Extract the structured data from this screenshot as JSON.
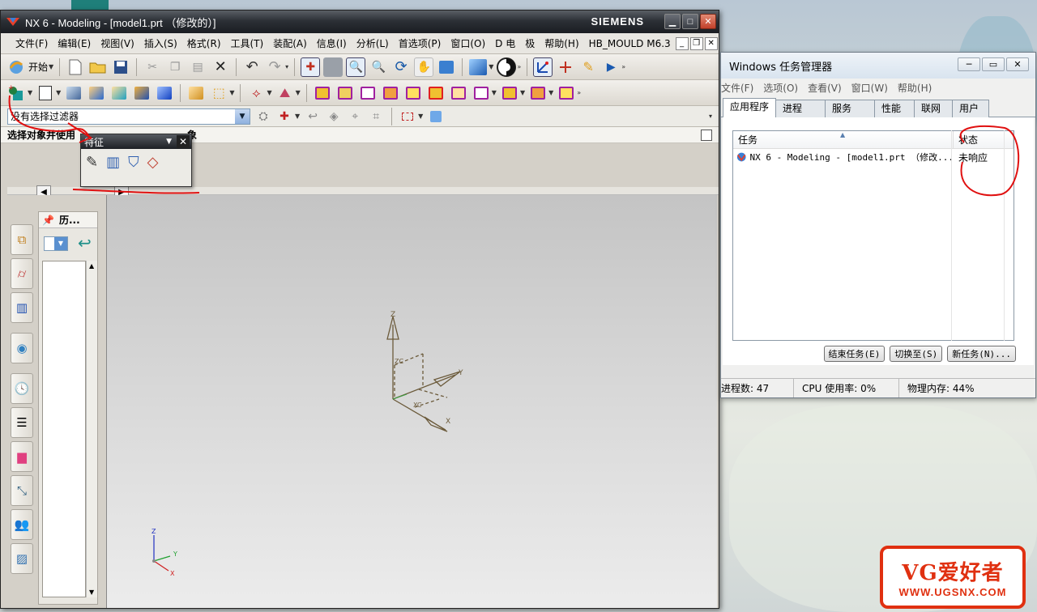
{
  "nx": {
    "title": "NX 6 - Modeling - [model1.prt （修改的）]",
    "brand": "SIEMENS",
    "menu": [
      "文件(F)",
      "编辑(E)",
      "视图(V)",
      "插入(S)",
      "格式(R)",
      "工具(T)",
      "装配(A)",
      "信息(I)",
      "分析(L)",
      "首选项(P)",
      "窗口(O)",
      "D 电",
      "极",
      "帮助(H)",
      "HB_MOULD M6.3"
    ],
    "toolbar": {
      "start_label": "开始"
    },
    "selection": {
      "filter_value": "没有选择过滤器"
    },
    "cue_line": "选择对象并使用",
    "cue_tail": "象",
    "feature_toolbar": {
      "title": "特征"
    },
    "navigator": {
      "tab_label": "历..."
    },
    "triad": {
      "z": "Z",
      "y": "Y",
      "x": "X",
      "zc": "ZC",
      "xc": "XC"
    }
  },
  "task_manager": {
    "title": "Windows 任务管理器",
    "menu": [
      "文件(F)",
      "选项(O)",
      "查看(V)",
      "窗口(W)",
      "帮助(H)"
    ],
    "tabs": [
      "应用程序",
      "进程",
      "服务",
      "性能",
      "联网",
      "用户"
    ],
    "columns": {
      "task": "任务",
      "status": "状态"
    },
    "rows": [
      {
        "task": "NX 6 - Modeling - [model1.prt （修改...",
        "status": "未响应"
      }
    ],
    "buttons": {
      "end_task": "结束任务(E)",
      "switch_to": "切换至(S)",
      "new_task": "新任务(N)..."
    },
    "status": {
      "processes": "进程数: 47",
      "cpu": "CPU 使用率: 0%",
      "memory": "物理内存: 44%"
    }
  },
  "watermark": {
    "big": "VG爱好者",
    "small": "WWW.UGSNX.COM"
  },
  "colors": {
    "annotation_red": "#e01010",
    "tm_border": "#6e7a86",
    "logo_red": "#e03010"
  }
}
